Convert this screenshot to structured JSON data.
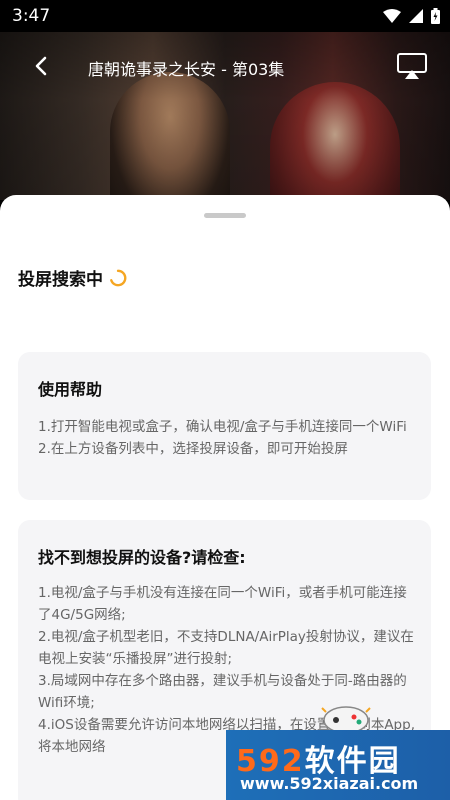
{
  "status_bar": {
    "time": "3:47",
    "icons": [
      "wifi-icon",
      "signal-icon",
      "battery-icon"
    ]
  },
  "player": {
    "title": "唐朝诡事录之长安 - 第03集",
    "back_icon": "chevron-left-icon",
    "cast_icon": "airplay-icon"
  },
  "sheet": {
    "search_status": "投屏搜索中",
    "help": {
      "title": "使用帮助",
      "lines": [
        "1.打开智能电视或盒子，确认电视/盒子与手机连接同一个WiFi",
        "2.在上方设备列表中，选择投屏设备，即可开始投屏"
      ]
    },
    "check": {
      "title": "找不到想投屏的设备?请检查:",
      "lines": [
        "1.电视/盒子与手机没有连接在同一个WiFi，或者手机可能连接了4G/5G网络;",
        "2.电视/盒子机型老旧，不支持DLNA/AirPlay投射协议，建议在电视上安装“乐播投屏”进行投射;",
        "3.局域网中存在多个路由器，建议手机与设备处于同-路由器的Wifi环境;",
        "4.iOS设备需要允许访问本地网络以扫描，在设置中找到本App,将本地网络"
      ]
    }
  },
  "watermark": {
    "logo_num": "592",
    "logo_text": "软件园",
    "url": "www.592xiazai.com"
  },
  "colors": {
    "sheet_bg": "#ffffff",
    "card_bg": "#f5f5f7",
    "spinner": "#f5a623",
    "watermark_bg": "#1e6fb8",
    "watermark_accent": "#ff6a1a"
  }
}
